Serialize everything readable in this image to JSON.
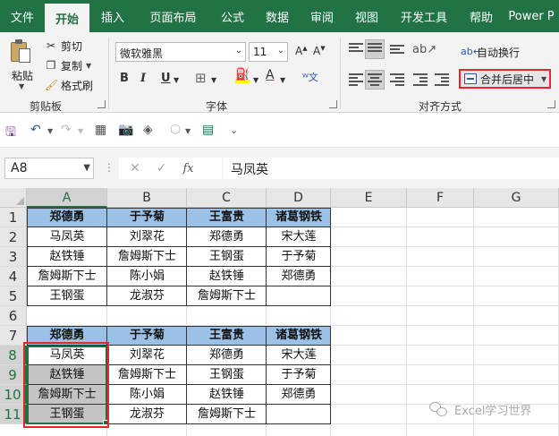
{
  "ribbon_tabs": [
    "文件",
    "开始",
    "插入",
    "页面布局",
    "公式",
    "数据",
    "审阅",
    "视图",
    "开发工具",
    "帮助",
    "Power P"
  ],
  "active_tab": "开始",
  "clipboard": {
    "paste": "粘贴",
    "cut": "剪切",
    "copy": "复制",
    "format_painter": "格式刷",
    "group": "剪贴板"
  },
  "font": {
    "name": "微软雅黑",
    "size": "11",
    "bold": "B",
    "italic": "I",
    "underline": "U",
    "font_color_letter": "A",
    "group": "字体"
  },
  "alignment": {
    "wrap_text": "自动换行",
    "merge_center": "合并后居中",
    "group": "对齐方式"
  },
  "formula_bar": {
    "name_box": "A8",
    "fx": "fx",
    "cancel": "✕",
    "enter": "✓",
    "formula": "马凤英"
  },
  "columns": [
    "A",
    "B",
    "C",
    "D",
    "E",
    "F",
    "G"
  ],
  "rows": [
    "1",
    "2",
    "3",
    "4",
    "5",
    "6",
    "7",
    "8",
    "9",
    "10",
    "11"
  ],
  "table1": {
    "headers": [
      "郑德勇",
      "于予菊",
      "王富贵",
      "诸葛钢铁"
    ],
    "rows": [
      [
        "马凤英",
        "刘翠花",
        "郑德勇",
        "宋大莲"
      ],
      [
        "赵铁锤",
        "詹姆斯下士",
        "王钢蛋",
        "于予菊"
      ],
      [
        "詹姆斯下士",
        "陈小娟",
        "赵铁锤",
        "郑德勇"
      ],
      [
        "王钢蛋",
        "龙淑芬",
        "詹姆斯下士",
        ""
      ]
    ]
  },
  "table2": {
    "headers": [
      "郑德勇",
      "于予菊",
      "王富贵",
      "诸葛钢铁"
    ],
    "rows": [
      [
        "马凤英",
        "刘翠花",
        "郑德勇",
        "宋大莲"
      ],
      [
        "赵铁锤",
        "詹姆斯下士",
        "王钢蛋",
        "于予菊"
      ],
      [
        "詹姆斯下士",
        "陈小娟",
        "赵铁锤",
        "郑德勇"
      ],
      [
        "王钢蛋",
        "龙淑芬",
        "詹姆斯下士",
        ""
      ]
    ]
  },
  "watermark": "Excel学习世界",
  "colors": {
    "excel_green": "#217346",
    "header_fill": "#9bc2e6",
    "selected_fill": "#c4c4c4",
    "highlight_red": "#e8262b"
  }
}
